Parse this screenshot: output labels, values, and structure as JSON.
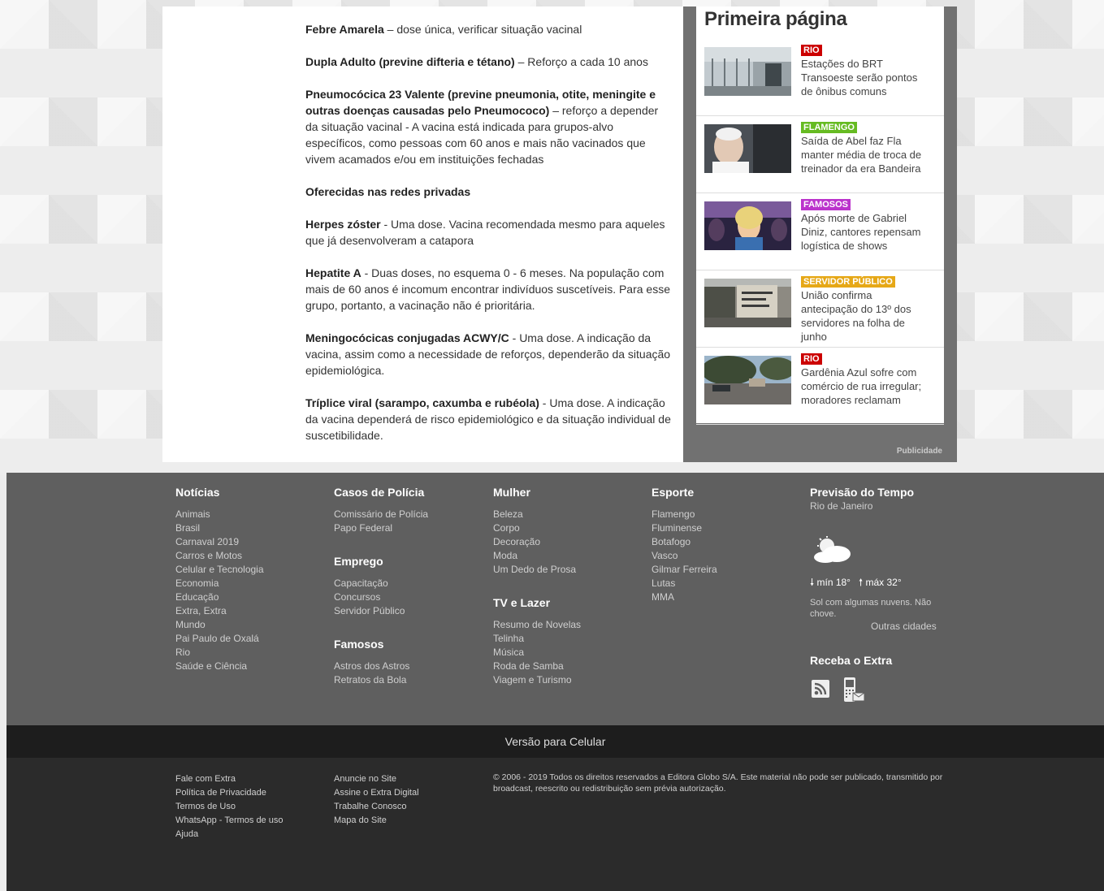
{
  "article": {
    "paragraphs": [
      {
        "bold": "Febre Amarela",
        "text": " – dose única, verificar situação vacinal"
      },
      {
        "bold": "Dupla Adulto (previne difteria e tétano)",
        "text": " – Reforço a cada 10 anos"
      },
      {
        "bold": "Pneumocócica 23 Valente (previne pneumonia, otite, meningite e outras doenças causadas pelo Pneumococo)",
        "text": " – reforço a depender da situação vacinal - A vacina está indicada para grupos-alvo específicos, como pessoas com 60 anos e mais não vacinados que vivem acamados e/ou em instituições fechadas"
      },
      {
        "bold": "Oferecidas nas redes privadas",
        "text": ""
      },
      {
        "bold": "Herpes zóster",
        "text": " - Uma dose. Vacina recomendada mesmo para aqueles que já desenvolveram a catapora"
      },
      {
        "bold": "Hepatite A",
        "text": " - Duas doses, no esquema 0 - 6 meses. Na população com mais de 60 anos é incomum encontrar indivíduos suscetíveis. Para esse grupo, portanto, a vacinação não é prioritária."
      },
      {
        "bold": "Meningocócicas conjugadas ACWY/C",
        "text": " - Uma dose. A indicação da vacina, assim como a necessidade de reforços, dependerão da situação epidemiológica."
      },
      {
        "bold": "Tríplice viral (sarampo, caxumba e rubéola)",
        "text": " - Uma dose. A indicação da vacina dependerá de risco epidemiológico e da situação individual de suscetibilidade."
      }
    ]
  },
  "sidebar": {
    "title": "Primeira página",
    "stories": [
      {
        "tag": "RIO",
        "tag_color": "#cc0000",
        "headline": "Estações do BRT Transoeste serão pontos de ônibus comuns",
        "thumb": "brt-station-photo"
      },
      {
        "tag": "FLAMENGO",
        "tag_color": "#66bb22",
        "headline": "Saída de Abel faz Fla manter média de troca de treinador da era Bandeira",
        "thumb": "coach-photo"
      },
      {
        "tag": "FAMOSOS",
        "tag_color": "#bb33cc",
        "headline": "Após morte de Gabriel Diniz, cantores repensam logística de shows",
        "thumb": "singer-photo"
      },
      {
        "tag": "SERVIDOR PÚBLICO",
        "tag_color": "#e6a817",
        "headline": "União confirma antecipação do 13º dos servidores na folha de junho",
        "thumb": "ministry-building-photo"
      },
      {
        "tag": "RIO",
        "tag_color": "#cc0000",
        "headline": "Gardênia Azul sofre com comércio de rua irregular; moradores reclamam",
        "thumb": "street-photo"
      }
    ],
    "ad_label": "Publicidade"
  },
  "footer": {
    "columns": [
      {
        "groups": [
          {
            "title": "Notícias",
            "links": [
              "Animais",
              "Brasil",
              "Carnaval 2019",
              "Carros e Motos",
              "Celular e Tecnologia",
              "Economia",
              "Educação",
              "Extra, Extra",
              "Mundo",
              "Pai Paulo de Oxalá",
              "Rio",
              "Saúde e Ciência"
            ]
          }
        ]
      },
      {
        "groups": [
          {
            "title": "Casos de Polícia",
            "links": [
              "Comissário de Polícia",
              "Papo Federal"
            ]
          },
          {
            "title": "Emprego",
            "links": [
              "Capacitação",
              "Concursos",
              "Servidor Público"
            ]
          },
          {
            "title": "Famosos",
            "links": [
              "Astros dos Astros",
              "Retratos da Bola"
            ]
          }
        ]
      },
      {
        "groups": [
          {
            "title": "Mulher",
            "links": [
              "Beleza",
              "Corpo",
              "Decoração",
              "Moda",
              "Um Dedo de Prosa"
            ]
          },
          {
            "title": "TV e Lazer",
            "links": [
              "Resumo de Novelas",
              "Telinha",
              "Música",
              "Roda de Samba",
              "Viagem e Turismo"
            ]
          }
        ]
      },
      {
        "groups": [
          {
            "title": "Esporte",
            "links": [
              "Flamengo",
              "Fluminense",
              "Botafogo",
              "Vasco",
              "Gilmar Ferreira",
              "Lutas",
              "MMA"
            ]
          }
        ]
      }
    ],
    "weather": {
      "title": "Previsão do Tempo",
      "city": "Rio de Janeiro",
      "icon": "partly-cloudy-icon",
      "temps": "mín 18°   máx 32°",
      "min": "mín 18°",
      "max": "máx 32°",
      "description": "Sol com algumas nuvens. Não chove.",
      "other_cities": "Outras cidades"
    },
    "subscribe": {
      "title": "Receba o Extra",
      "icons": [
        "rss-icon",
        "mobile-sms-icon"
      ]
    }
  },
  "mobile_bar": {
    "label": "Versão para Celular"
  },
  "bottom": {
    "col1": [
      "Fale com Extra",
      "Política de Privacidade",
      "Termos de Uso",
      "WhatsApp - Termos de uso",
      "Ajuda"
    ],
    "col2": [
      "Anuncie no Site",
      "Assine o Extra Digital",
      "Trabalhe Conosco",
      "Mapa do Site"
    ],
    "copyright": "© 2006 - 2019 Todos os direitos reservados a Editora Globo S/A. Este material não pode ser publicado, transmitido por broadcast, reescrito ou redistribuição sem prévia autorização."
  }
}
